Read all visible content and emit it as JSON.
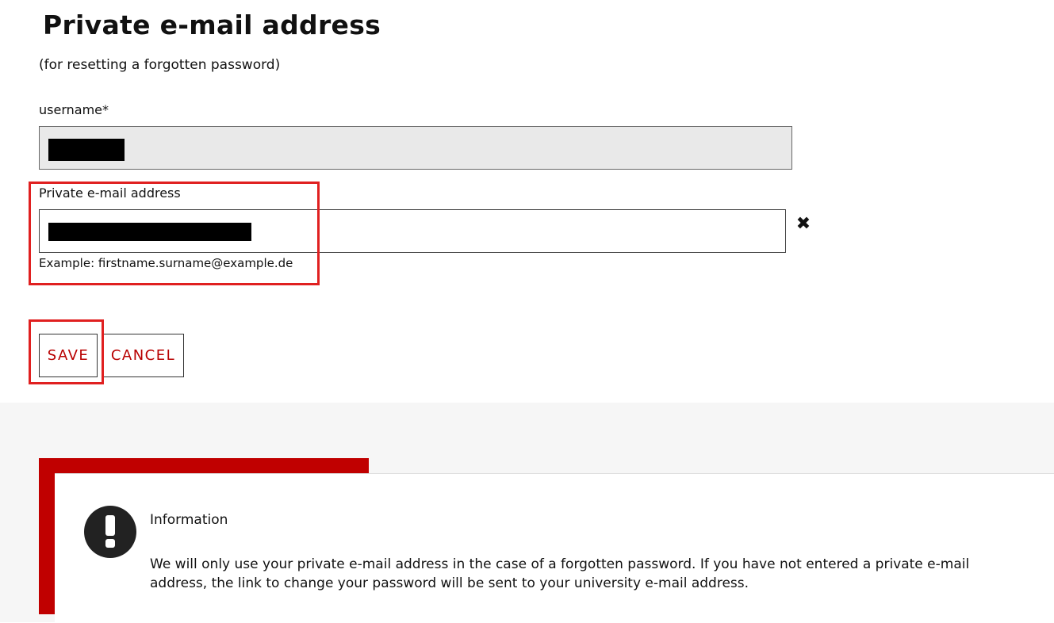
{
  "page_title": "Private e-mail address",
  "subtitle": "(for resetting a forgotten password)",
  "form": {
    "username_label": "username*",
    "email_label": "Private e-mail address",
    "email_hint": "Example: firstname.surname@example.de"
  },
  "actions": {
    "save_label": "SAVE",
    "cancel_label": "CANCEL",
    "clear_glyph": "✖"
  },
  "info": {
    "title": "Information",
    "text": "We will only use your private e-mail address in the case of a forgotten password. If you have not entered a private e-mail address, the link to change your password will be sent to your university e-mail address.",
    "icon": "exclamation-icon"
  },
  "colors": {
    "accent": "#c00000",
    "button_text": "#b80000",
    "highlight": "#e02020",
    "disabled_input": "#e9e9e9",
    "footer_bg": "#f6f6f6"
  }
}
